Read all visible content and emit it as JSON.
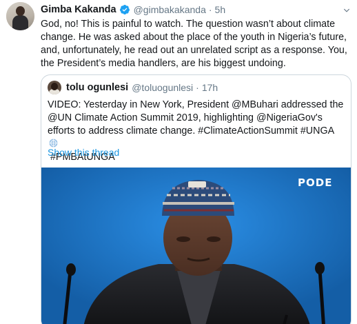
{
  "tweet": {
    "author_name": "Gimba Kakanda",
    "handle": "@gimbakakanda",
    "separator": "·",
    "time": "5h",
    "text": "God, no! This is painful to watch. The question wasn’t about climate change. He was asked about the place of the youth in Nigeria’s future, and, unfortunately, he read out an unrelated script as a response. You, the President’s media handlers, are his biggest undoing."
  },
  "quote": {
    "author_name": "tolu ogunlesi",
    "handle": "@toluogunlesi",
    "separator": "·",
    "time": "17h",
    "text_main": "VIDEO: Yesterday in New York, President @MBuhari addressed the @UN Climate Action Summit 2019, highlighting @NigeriaGov's efforts to address climate change. #ClimateActionSummit #UNGA",
    "text_tail": "#PMBAtUNGA",
    "show_thread": "Show this thread",
    "video_watermark": "PODE"
  },
  "colors": {
    "text": "#14171a",
    "secondary": "#657786",
    "link": "#1b95e0",
    "verified": "#1da1f2",
    "border": "#ccd6dd",
    "video_bg": "#1a76c9"
  },
  "icons": {
    "verified": "verified-badge-icon",
    "caret": "chevron-down-icon",
    "globe": "un-globe-emoji-icon"
  }
}
